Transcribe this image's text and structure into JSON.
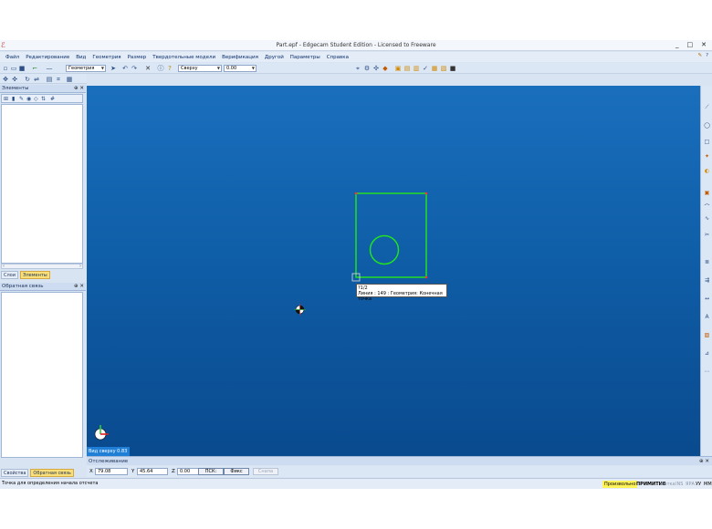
{
  "window": {
    "title": "Part.epf - Edgecam Student Edition - Licensed to Freeware",
    "app_icon": "edgecam-logo-icon",
    "controls": [
      "_",
      "□",
      "✕"
    ]
  },
  "menu": {
    "items": [
      "Файл",
      "Редактирование",
      "Вид",
      "Геометрия",
      "Размер",
      "Твердотельные модели",
      "Верификация",
      "Другой",
      "Параметры",
      "Справка"
    ]
  },
  "toolbar": {
    "geometry_combo": "Геометрия",
    "view_combo": "Сверху",
    "value_combo": "0.00"
  },
  "elements_panel": {
    "title": "Элементы",
    "tabs": [
      "Слои",
      "Элементы"
    ],
    "active_tab": "Элементы"
  },
  "feedback_panel": {
    "title": "Обратная связь",
    "tabs": [
      "Свойства",
      "Обратная связь"
    ],
    "active_tab": "Обратная связь"
  },
  "viewport": {
    "tooltip_line1": "?1/2",
    "tooltip_line2": "Линия : 149 : Геометрия: Конечная точка",
    "view_label": "Вид сверху 0.83",
    "geometry_color": "#22e022",
    "background_color": "#0f5ea8"
  },
  "tracking": {
    "title": "Отслеживание"
  },
  "coords": {
    "x_label": "X",
    "x_value": "79.08",
    "y_label": "Y",
    "y_value": "45.64",
    "z_label": "Z",
    "z_value": "0.00",
    "psk_button": "ПСК:",
    "fix_button": "Фикс",
    "snap_button": "Снапа"
  },
  "statusbar": {
    "message": "Точка для определения начала отсчета",
    "mode_ortho": "Произвольно",
    "mode_primitive": "ПРИМИТИВ",
    "mode_grid": "Сетка",
    "mode_ins": "INS",
    "mode_ipa": "ЯРА",
    "mode_yy": "УУ",
    "mode_mm": "ММ"
  }
}
